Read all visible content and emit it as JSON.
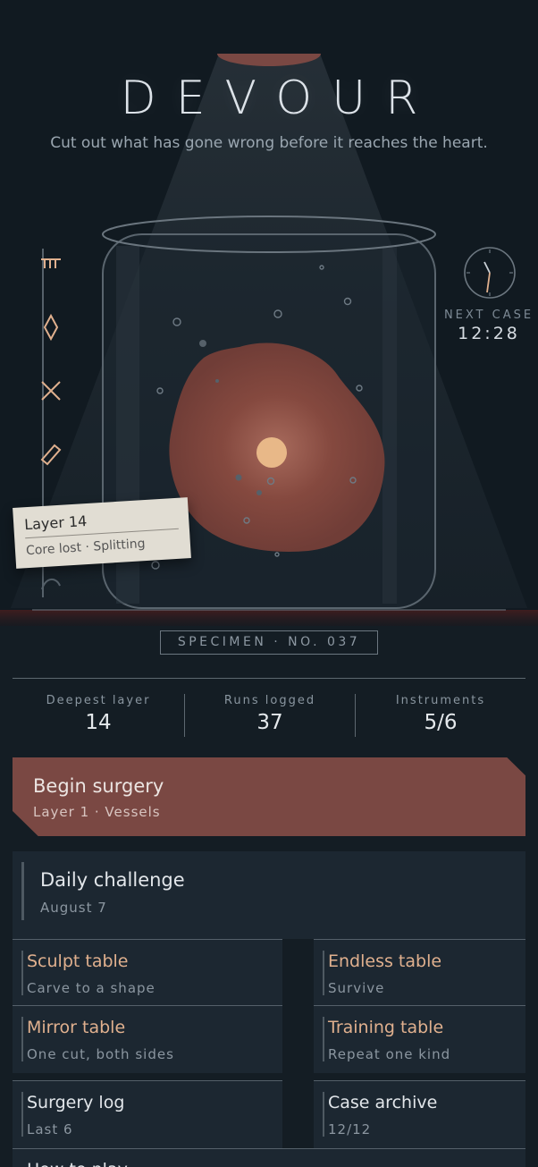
{
  "header": {
    "title": "DEVOUR",
    "tagline": "Cut out what has gone wrong before it reaches the heart."
  },
  "next_case": {
    "label": "NEXT CASE",
    "time": "12:28"
  },
  "layer_card": {
    "title": "Layer 14",
    "subtitle": "Core lost · Splitting"
  },
  "specimen": "SPECIMEN · NO. 037",
  "stats": [
    {
      "label": "Deepest layer",
      "value": "14"
    },
    {
      "label": "Runs logged",
      "value": "37"
    },
    {
      "label": "Instruments",
      "value": "5/6"
    }
  ],
  "begin": {
    "title": "Begin surgery",
    "subtitle": "Layer 1 · Vessels"
  },
  "daily": {
    "title": "Daily challenge",
    "subtitle": "August 7"
  },
  "modes": [
    {
      "title": "Sculpt table",
      "subtitle": "Carve to a shape"
    },
    {
      "title": "Endless table",
      "subtitle": "Survive"
    },
    {
      "title": "Mirror table",
      "subtitle": "One cut, both sides"
    },
    {
      "title": "Training table",
      "subtitle": "Repeat one kind"
    },
    {
      "title": "Surgery log",
      "subtitle": "Last 6"
    },
    {
      "title": "Case archive",
      "subtitle": "12/12"
    }
  ],
  "bottom": {
    "title": "How to play"
  },
  "colors": {
    "background": "#111a21",
    "accent": "#e0b08e",
    "primary_button": "#7a4843",
    "organ": "#7e453e",
    "core": "#e8b888"
  }
}
